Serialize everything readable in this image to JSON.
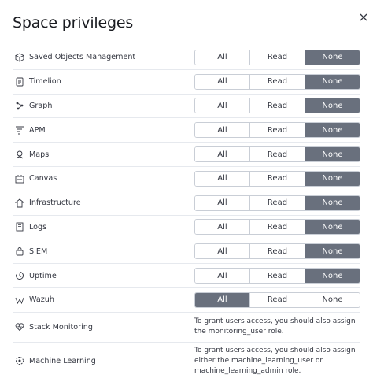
{
  "title": "Space privileges",
  "options": [
    "All",
    "Read",
    "None"
  ],
  "features": [
    {
      "label": "Saved Objects Management",
      "icon": "saved-objects-icon",
      "selected": "None"
    },
    {
      "label": "Timelion",
      "icon": "timelion-icon",
      "selected": "None"
    },
    {
      "label": "Graph",
      "icon": "graph-icon",
      "selected": "None"
    },
    {
      "label": "APM",
      "icon": "apm-icon",
      "selected": "None"
    },
    {
      "label": "Maps",
      "icon": "maps-icon",
      "selected": "None"
    },
    {
      "label": "Canvas",
      "icon": "canvas-icon",
      "selected": "None"
    },
    {
      "label": "Infrastructure",
      "icon": "infrastructure-icon",
      "selected": "None"
    },
    {
      "label": "Logs",
      "icon": "logs-icon",
      "selected": "None"
    },
    {
      "label": "SIEM",
      "icon": "siem-icon",
      "selected": "None"
    },
    {
      "label": "Uptime",
      "icon": "uptime-icon",
      "selected": "None"
    },
    {
      "label": "Wazuh",
      "icon": "wazuh-icon",
      "selected": "All"
    }
  ],
  "notes": [
    {
      "label": "Stack Monitoring",
      "icon": "stack-monitoring-icon",
      "text": "To grant users access, you should also assign the monitoring_user role."
    },
    {
      "label": "Machine Learning",
      "icon": "machine-learning-icon",
      "text": "To grant users access, you should also assign either the machine_learning_user or machine_learning_admin role."
    }
  ]
}
